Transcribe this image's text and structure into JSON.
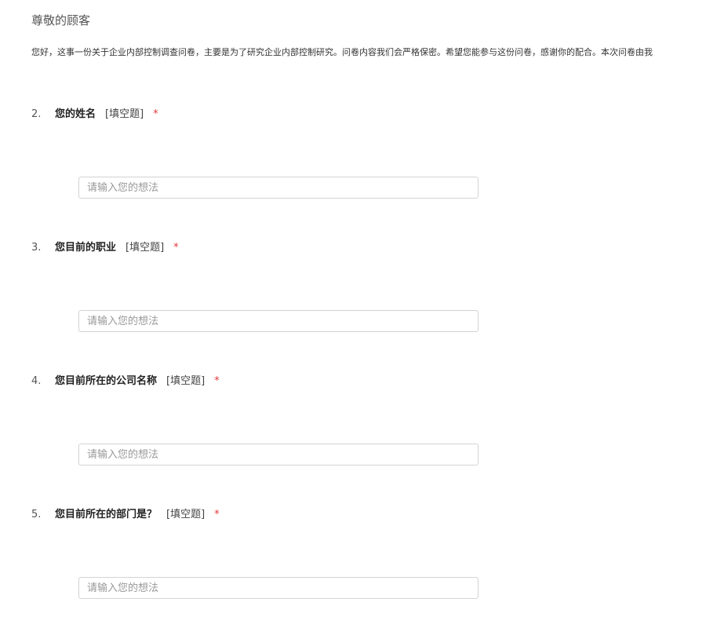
{
  "survey": {
    "greeting": "尊敬的顾客",
    "intro": "您好，这事一份关于企业内部控制调查问卷，主要是为了研究企业内部控制研究。问卷内容我们会严格保密。希望您能参与这份问卷，感谢你的配合。本次问卷由我"
  },
  "questions": [
    {
      "number": "2.",
      "title": "您的姓名",
      "type": "[填空题]",
      "required": "*",
      "value": "",
      "placeholder": "请输入您的想法"
    },
    {
      "number": "3.",
      "title": "您目前的职业",
      "type": "[填空题]",
      "required": "*",
      "value": "",
      "placeholder": "请输入您的想法"
    },
    {
      "number": "4.",
      "title": "您目前所在的公司名称",
      "type": "[填空题]",
      "required": "*",
      "value": "",
      "placeholder": "请输入您的想法"
    },
    {
      "number": "5.",
      "title": "您目前所在的部门是？",
      "type": "[填空题]",
      "required": "*",
      "value": "",
      "placeholder": "请输入您的想法"
    }
  ]
}
